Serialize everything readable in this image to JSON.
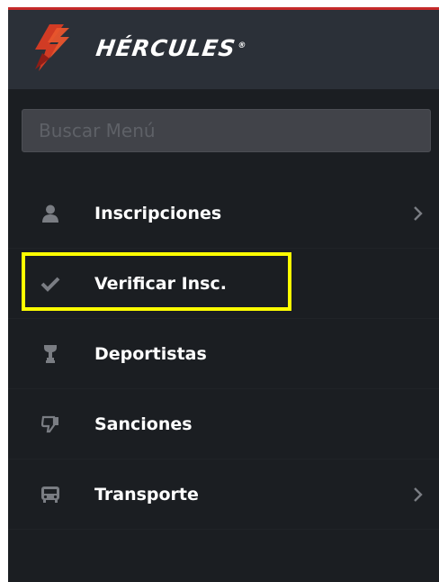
{
  "header": {
    "logo_text": "HÉRCULES",
    "logo_reg": "®",
    "logo_icon": "hercules-flame-logo"
  },
  "search": {
    "placeholder": "Buscar Menú",
    "value": ""
  },
  "menu": {
    "items": [
      {
        "label": "Inscripciones",
        "icon": "user-icon",
        "has_submenu": true
      },
      {
        "label": "Verificar Insc.",
        "icon": "check-icon",
        "has_submenu": false,
        "highlighted": true
      },
      {
        "label": "Deportistas",
        "icon": "trophy-icon",
        "has_submenu": false
      },
      {
        "label": "Sanciones",
        "icon": "thumbs-down-icon",
        "has_submenu": false
      },
      {
        "label": "Transporte",
        "icon": "bus-icon",
        "has_submenu": true
      }
    ]
  },
  "colors": {
    "sidebar_bg": "#1b1e22",
    "header_bg": "#2b3038",
    "accent_red": "#c52a2a",
    "highlight": "#ffff00",
    "icon_gray": "#7a7d83",
    "text": "#ffffff"
  }
}
